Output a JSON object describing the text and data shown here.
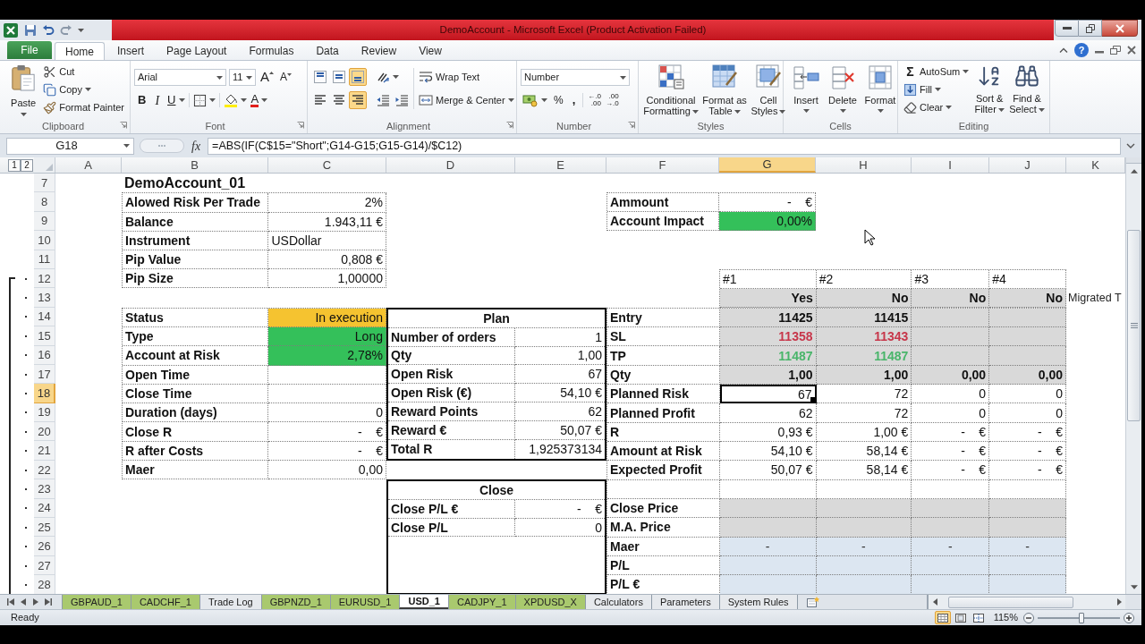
{
  "window": {
    "title": "DemoAccount - Microsoft Excel (Product Activation Failed)"
  },
  "ribbon": {
    "tabs": [
      {
        "label": "File",
        "kind": "file",
        "selected": false
      },
      {
        "label": "Home",
        "kind": "tab",
        "selected": true
      },
      {
        "label": "Insert",
        "kind": "tab",
        "selected": false
      },
      {
        "label": "Page Layout",
        "kind": "tab",
        "selected": false
      },
      {
        "label": "Formulas",
        "kind": "tab",
        "selected": false
      },
      {
        "label": "Data",
        "kind": "tab",
        "selected": false
      },
      {
        "label": "Review",
        "kind": "tab",
        "selected": false
      },
      {
        "label": "View",
        "kind": "tab",
        "selected": false
      }
    ],
    "help": "?",
    "clipboard": {
      "paste": "Paste",
      "cut": "Cut",
      "copy": "Copy",
      "format_painter": "Format Painter",
      "label": "Clipboard"
    },
    "font": {
      "name": "Arial",
      "size": "11",
      "grow": "A",
      "shrink": "A",
      "bold": "B",
      "italic": "I",
      "underline": "U",
      "font_color": "A",
      "label": "Font"
    },
    "alignment": {
      "vertical": [
        {
          "kind": "top",
          "selected": false
        },
        {
          "kind": "middle",
          "selected": false
        },
        {
          "kind": "bottom",
          "selected": true
        }
      ],
      "horizontal": [
        {
          "kind": "left",
          "selected": false
        },
        {
          "kind": "center",
          "selected": false
        },
        {
          "kind": "right",
          "selected": true
        }
      ],
      "wrap_text": "Wrap Text",
      "merge": "Merge & Center",
      "label": "Alignment"
    },
    "number": {
      "format": "Number",
      "percent": "%",
      "comma": ",",
      "increase_decimal": [
        "←.0",
        ".00"
      ],
      "decrease_decimal": [
        ".00",
        "→.0"
      ],
      "label": "Number"
    },
    "styles": {
      "buttons": [
        {
          "kind": "conditional",
          "label": "Conditional Formatting"
        },
        {
          "kind": "table",
          "label": "Format as Table"
        },
        {
          "kind": "cell_styles",
          "label": "Cell Styles"
        }
      ],
      "label": "Styles"
    },
    "cells": {
      "buttons": [
        {
          "kind": "insert",
          "label": "Insert"
        },
        {
          "kind": "delete",
          "label": "Delete"
        },
        {
          "kind": "format",
          "label": "Format"
        }
      ],
      "label": "Cells"
    },
    "editing": {
      "autosum_symbol": "Σ",
      "autosum": "AutoSum",
      "fill": "Fill",
      "clear": "Clear",
      "sort": "Sort & Filter",
      "find": "Find & Select",
      "label": "Editing"
    }
  },
  "formula_bar": {
    "name_box": "G18",
    "function_label": "fx",
    "formula": "=ABS(IF(C$15=\"Short\";G14-G15;G15-G14)/$C12)"
  },
  "sheet": {
    "outline_levels": [
      "1",
      "2"
    ],
    "columns": [
      {
        "label": "A",
        "selected": false
      },
      {
        "label": "B",
        "selected": false
      },
      {
        "label": "C",
        "selected": false
      },
      {
        "label": "D",
        "selected": false
      },
      {
        "label": "E",
        "selected": false
      },
      {
        "label": "F",
        "selected": false
      },
      {
        "label": "G",
        "selected": true
      },
      {
        "label": "H",
        "selected": false
      },
      {
        "label": "I",
        "selected": false
      },
      {
        "label": "J",
        "selected": false
      },
      {
        "label": "K",
        "selected": false
      }
    ],
    "rows": [
      {
        "label": "7",
        "selected": false,
        "grouped": false
      },
      {
        "label": "8",
        "selected": false,
        "grouped": false
      },
      {
        "label": "9",
        "selected": false,
        "grouped": false
      },
      {
        "label": "10",
        "selected": false,
        "grouped": false
      },
      {
        "label": "11",
        "selected": false,
        "grouped": false
      },
      {
        "label": "12",
        "selected": false,
        "grouped": true
      },
      {
        "label": "13",
        "selected": false,
        "grouped": true
      },
      {
        "label": "14",
        "selected": false,
        "grouped": true
      },
      {
        "label": "15",
        "selected": false,
        "grouped": true
      },
      {
        "label": "16",
        "selected": false,
        "grouped": true
      },
      {
        "label": "17",
        "selected": false,
        "grouped": true
      },
      {
        "label": "18",
        "selected": true,
        "grouped": true
      },
      {
        "label": "19",
        "selected": false,
        "grouped": true
      },
      {
        "label": "20",
        "selected": false,
        "grouped": true
      },
      {
        "label": "21",
        "selected": false,
        "grouped": true
      },
      {
        "label": "22",
        "selected": false,
        "grouped": true
      },
      {
        "label": "23",
        "selected": false,
        "grouped": true
      },
      {
        "label": "24",
        "selected": false,
        "grouped": true
      },
      {
        "label": "25",
        "selected": false,
        "grouped": true
      },
      {
        "label": "26",
        "selected": false,
        "grouped": true
      },
      {
        "label": "27",
        "selected": false,
        "grouped": true
      },
      {
        "label": "28",
        "selected": false,
        "grouped": true
      }
    ],
    "title": "DemoAccount_01",
    "account": [
      {
        "label": "Alowed Risk Per Trade",
        "value": "2%",
        "kind": "number"
      },
      {
        "label": "Balance",
        "value": "1.943,11 €",
        "kind": "number"
      },
      {
        "label": "Instrument",
        "value": "USDollar",
        "kind": "text"
      },
      {
        "label": "Pip Value",
        "value": "0,808 €",
        "kind": "number"
      },
      {
        "label": "Pip Size",
        "value": "1,00000",
        "kind": "number"
      }
    ],
    "impact": [
      {
        "label": "Ammount",
        "value": "-    €"
      },
      {
        "label": "Account Impact",
        "value": "0,00%",
        "color": "#34c05a"
      }
    ],
    "trade": [
      {
        "label": "Status",
        "value": "In execution",
        "color": "#f5c330"
      },
      {
        "label": "Type",
        "value": "Long",
        "color": "#34c05a"
      },
      {
        "label": "Account at Risk",
        "value": "2,78%",
        "color": "#34c05a"
      },
      {
        "label": "Open Time"
      },
      {
        "label": "Close Time"
      },
      {
        "label": "Duration (days)",
        "value": "0"
      },
      {
        "label": "Close R",
        "value": "-    €"
      },
      {
        "label": "R after Costs",
        "value": "-    €"
      },
      {
        "label": "Maer",
        "value": "0,00"
      }
    ],
    "plan": {
      "title": "Plan",
      "rows": [
        {
          "label": "Number of orders",
          "value": "1"
        },
        {
          "label": "Qty",
          "value": "1,00"
        },
        {
          "label": "Open Risk",
          "value": "67"
        },
        {
          "label": "Open Risk (€)",
          "value": "54,10 €"
        },
        {
          "label": "Reward Points",
          "value": "62"
        },
        {
          "label": "Reward €",
          "value": "50,07 €"
        },
        {
          "label": "Total R",
          "value": "1,925373134"
        }
      ]
    },
    "close": {
      "title": "Close",
      "rows": [
        {
          "label": "Close P/L €",
          "value": "-    €"
        },
        {
          "label": "Close P/L",
          "value": "0"
        }
      ]
    },
    "orders": {
      "columns": [
        {
          "label": "#1",
          "status": "Yes"
        },
        {
          "label": "#2",
          "status": "No"
        },
        {
          "label": "#3",
          "status": "No"
        },
        {
          "label": "#4",
          "status": "No"
        }
      ],
      "rows": [
        {
          "label": "Entry",
          "kind": "fixed",
          "values": [
            {
              "text": "11425",
              "selected": false
            },
            {
              "text": "11415",
              "selected": false
            }
          ]
        },
        {
          "label": "SL",
          "kind": "stop_loss",
          "values": [
            {
              "text": "11358",
              "selected": false
            },
            {
              "text": "11343",
              "selected": false
            }
          ]
        },
        {
          "label": "TP",
          "kind": "take_profit",
          "values": [
            {
              "text": "11487",
              "selected": false
            },
            {
              "text": "11487",
              "selected": false
            }
          ]
        },
        {
          "label": "Qty",
          "kind": "fixed",
          "values": [
            {
              "text": "1,00",
              "selected": false
            },
            {
              "text": "1,00",
              "selected": false
            },
            {
              "text": "0,00",
              "selected": false
            },
            {
              "text": "0,00",
              "selected": false
            }
          ]
        },
        {
          "label": "Planned Risk",
          "kind": "plain",
          "values": [
            {
              "text": "67",
              "selected": true
            },
            {
              "text": "72",
              "selected": false
            },
            {
              "text": "0",
              "selected": false
            },
            {
              "text": "0",
              "selected": false
            }
          ]
        },
        {
          "label": "Planned Profit",
          "kind": "plain",
          "values": [
            {
              "text": "62",
              "selected": false
            },
            {
              "text": "72",
              "selected": false
            },
            {
              "text": "0",
              "selected": false
            },
            {
              "text": "0",
              "selected": false
            }
          ]
        },
        {
          "label": "R",
          "kind": "plain",
          "values": [
            {
              "text": "0,93 €",
              "selected": false
            },
            {
              "text": "1,00 €",
              "selected": false
            },
            {
              "text": "-    €",
              "selected": false
            },
            {
              "text": "-    €",
              "selected": false
            }
          ]
        },
        {
          "label": "Amount at Risk",
          "kind": "plain",
          "values": [
            {
              "text": "54,10 €",
              "selected": false
            },
            {
              "text": "58,14 €",
              "selected": false
            },
            {
              "text": "-    €",
              "selected": false
            },
            {
              "text": "-    €",
              "selected": false
            }
          ]
        },
        {
          "label": "Expected Profit",
          "kind": "plain",
          "values": [
            {
              "text": "50,07 €",
              "selected": false
            },
            {
              "text": "58,14 €",
              "selected": false
            },
            {
              "text": "-    €",
              "selected": false
            },
            {
              "text": "-    €",
              "selected": false
            }
          ]
        },
        {
          "kind": "plain"
        },
        {
          "label": "Close Price",
          "kind": "input"
        },
        {
          "label": "M.A. Price",
          "kind": "input"
        },
        {
          "label": "Maer",
          "kind": "calculated",
          "values": [
            {
              "text": "-",
              "selected": false
            },
            {
              "text": "-",
              "selected": false
            },
            {
              "text": "-",
              "selected": false
            },
            {
              "text": "-",
              "selected": false
            }
          ]
        },
        {
          "label": "P/L",
          "kind": "calculated"
        },
        {
          "label": "P/L €",
          "kind": "calculated"
        }
      ]
    },
    "note": "Migrated T"
  },
  "sheet_tabs": [
    {
      "label": "GBPAUD_1",
      "selected": false,
      "color": "#a9c96e"
    },
    {
      "label": "CADCHF_1",
      "selected": false,
      "color": "#a9c96e"
    },
    {
      "label": "Trade Log",
      "selected": false
    },
    {
      "label": "GBPNZD_1",
      "selected": false,
      "color": "#a9c96e"
    },
    {
      "label": "EURUSD_1",
      "selected": false,
      "color": "#a9c96e"
    },
    {
      "label": "USD_1",
      "selected": true
    },
    {
      "label": "CADJPY_1",
      "selected": false,
      "color": "#a9c96e"
    },
    {
      "label": "XPDUSD_X",
      "selected": false,
      "color": "#a9c96e"
    },
    {
      "label": "Calculators",
      "selected": false
    },
    {
      "label": "Parameters",
      "selected": false
    },
    {
      "label": "System Rules",
      "selected": false
    }
  ],
  "status_bar": {
    "status": "Ready",
    "views": [
      {
        "kind": "normal",
        "selected": true
      },
      {
        "kind": "page_layout",
        "selected": false
      },
      {
        "kind": "page_break",
        "selected": false
      }
    ],
    "zoom": "115%",
    "zoom_slider": {
      "level": 0.53
    }
  }
}
